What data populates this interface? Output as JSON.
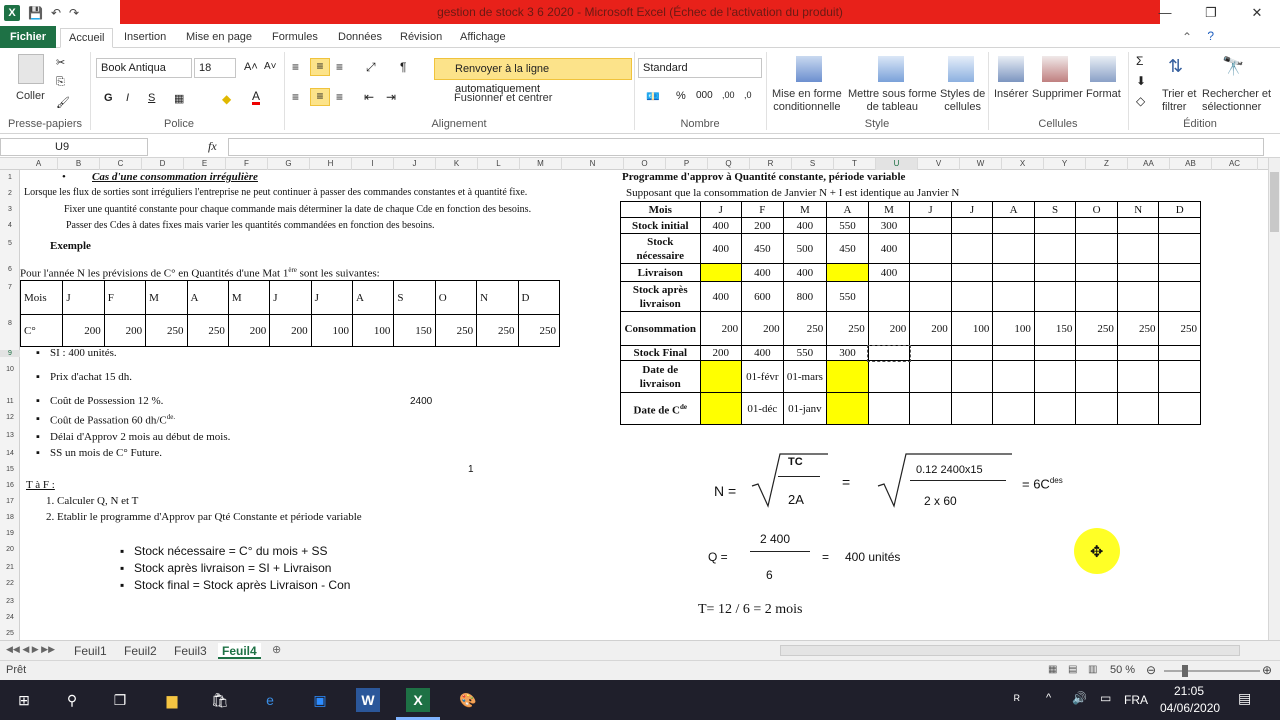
{
  "window": {
    "title": "gestion de stock 3 6 2020  -  Microsoft Excel (Échec de l'activation du produit)",
    "min": "—",
    "restore": "❐",
    "close": "✕"
  },
  "tabs": [
    "Fichier",
    "Accueil",
    "Insertion",
    "Mise en page",
    "Formules",
    "Données",
    "Révision",
    "Affichage"
  ],
  "ribbon": {
    "paste": "Coller",
    "clipboard": "Presse-papiers",
    "font_name": "Book Antiqua",
    "font_size": "18",
    "font_group": "Police",
    "wrap": "Renvoyer à la ligne automatiquement",
    "merge": "Fusionner et centrer",
    "alignment": "Alignement",
    "number_format": "Standard",
    "number": "Nombre",
    "cond": "Mise en forme\nconditionnelle",
    "table": "Mettre sous forme\nde tableau",
    "styles_btn": "Styles de\ncellules",
    "style": "Style",
    "insert": "Insérer",
    "delete": "Supprimer",
    "format": "Format",
    "cells": "Cellules",
    "sort": "Trier et\nfiltrer",
    "find": "Rechercher et\nsélectionner",
    "editing": "Édition"
  },
  "formula_bar": {
    "name_box": "U9",
    "fx": "fx",
    "value": ""
  },
  "columns": [
    "A",
    "B",
    "C",
    "D",
    "E",
    "F",
    "G",
    "H",
    "I",
    "J",
    "K",
    "L",
    "M",
    "N",
    "O",
    "P",
    "Q",
    "R",
    "S",
    "T",
    "U",
    "V",
    "W",
    "X",
    "Y",
    "Z",
    "AA",
    "AB",
    "AC"
  ],
  "rows": [
    "1",
    "2",
    "3",
    "4",
    "5",
    "6",
    "7",
    "8",
    "9",
    "10",
    "11",
    "12",
    "13",
    "14",
    "15",
    "16",
    "17",
    "18",
    "19",
    "20",
    "21",
    "22",
    "23",
    "24",
    "25"
  ],
  "left": {
    "title": "Cas d'une consommation irrégulière",
    "bullet": "•",
    "line2": "Lorsque les flux de sorties sont irréguliers l'entreprise ne peut continuer à passer des commandes constantes et à quantité fixe.",
    "line3": "Fixer une quantité constante pour chaque commande mais déterminer la date de chaque Cde en fonction des besoins.",
    "line4": "Passer des Cdes à dates fixes mais varier les quantités  commandées en fonction des besoins.",
    "exemple": "Exemple",
    "line6": "Pour l'année N les prévisions de C° en Quantités d'une Mat 1",
    "line6sup": "ère",
    "line6end": " sont les suivantes:",
    "months": [
      "Mois",
      "J",
      "F",
      "M",
      "A",
      "M",
      "J",
      "J",
      "A",
      "S",
      "O",
      "N",
      "D"
    ],
    "cons": [
      "C°",
      "200",
      "200",
      "250",
      "250",
      "200",
      "200",
      "100",
      "100",
      "150",
      "250",
      "250",
      "250"
    ],
    "si": "SI : 400 unités.",
    "prix": "Prix d'achat 15 dh.",
    "possession": "Coût de Possession 12 %.",
    "val2400": "2400",
    "passation": "Coût de Passation 60 dh/C",
    "passation_sup": "de.",
    "delai": "Délai d'Approv  2 mois au début de mois.",
    "ss": "SS un mois de C° Future.",
    "one": "1",
    "taf": "T à F :",
    "q1": "1.    Calculer Q, N et T",
    "q2": "2.    Etablir  le programme d'Approv par Qté Constante et période variable",
    "f1": "Stock nécessaire = C° du mois + SS",
    "f2": "Stock après livraison =    SI   +    Livraison",
    "f3": "Stock final  = Stock après  Livraison -   Con"
  },
  "right": {
    "title": "Programme d'approv à  Quantité constante, période variable",
    "subtitle": "Supposant que la consommation de Janvier N + I est identique au Janvier N",
    "header": [
      "Mois",
      "J",
      "F",
      "M",
      "A",
      "M",
      "J",
      "J",
      "A",
      "S",
      "O",
      "N",
      "D"
    ],
    "stock_initial": [
      "Stock initial",
      "400",
      "200",
      "400",
      "550",
      "300",
      "",
      "",
      "",
      "",
      "",
      "",
      ""
    ],
    "stock_necessaire": [
      "Stock nécessaire",
      "400",
      "450",
      "500",
      "450",
      "400",
      "",
      "",
      "",
      "",
      "",
      "",
      ""
    ],
    "livraison": [
      "Livraison",
      "",
      "400",
      "400",
      "",
      "400",
      "",
      "",
      "",
      "",
      "",
      "",
      ""
    ],
    "stock_apres": [
      "Stock après livraison",
      "400",
      "600",
      "800",
      "550",
      "",
      "",
      "",
      "",
      "",
      "",
      "",
      ""
    ],
    "consommation": [
      "Consommation",
      "200",
      "200",
      "250",
      "250",
      "200",
      "200",
      "100",
      "100",
      "150",
      "250",
      "250",
      "250"
    ],
    "stock_final": [
      "Stock Final",
      "200",
      "400",
      "550",
      "300",
      "",
      "",
      "",
      "",
      "",
      "",
      "",
      ""
    ],
    "date_livraison": [
      "Date de livraison",
      "",
      "01-févr",
      "01-mars",
      "",
      "",
      "",
      "",
      "",
      "",
      "",
      "",
      ""
    ],
    "date_cde": [
      "Date de C",
      "",
      "01-déc",
      "01-janv",
      "",
      "",
      "",
      "",
      "",
      "",
      "",
      "",
      ""
    ],
    "date_cde_sup": "de"
  },
  "formulas": {
    "n_label": "N =",
    "tc": "TC",
    "two_a": "2A",
    "eq": "=",
    "num": "0.12  2400x15",
    "den": "2 x 60",
    "n_result": "= 6C",
    "n_sup": "des",
    "q_label": "Q  =",
    "q_num": "2 400",
    "q_den": "6",
    "q_eq": "=",
    "q_result": "400 unités",
    "t": "T= 12 / 6 = 2 mois"
  },
  "sheets": [
    "Feuil1",
    "Feuil2",
    "Feuil3",
    "Feuil4"
  ],
  "status": {
    "ready": "Prêt",
    "zoom": "50 %"
  },
  "taskbar": {
    "lang": "FRA",
    "time": "21:05",
    "date": "04/06/2020"
  },
  "colors": {
    "excel_green": "#1e7145",
    "title_red": "#e8211a",
    "highlight": "#ffff00",
    "cursor": "#ffff00"
  }
}
